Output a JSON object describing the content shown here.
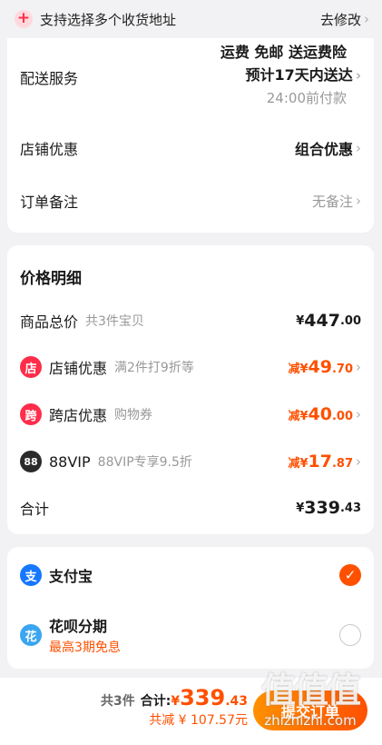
{
  "address": {
    "plus_icon": "+",
    "text": "支持选择多个收货地址",
    "modify": "去修改"
  },
  "shipping": {
    "label": "配送服务",
    "line1": "运费 免邮 送运费险",
    "line2": "预计17天内送达",
    "line3": "24:00前付款"
  },
  "store_discount": {
    "label": "店铺优惠",
    "value": "组合优惠"
  },
  "order_note": {
    "label": "订单备注",
    "value": "无备注"
  },
  "price_detail": {
    "title": "价格明细",
    "goods_total": {
      "label": "商品总价",
      "sub": "共3件宝贝",
      "yen": "¥",
      "int": "447",
      "dec": ".00"
    },
    "discounts": [
      {
        "icon_text": "店",
        "icon_color": "#ff2d4a",
        "label": "店铺优惠",
        "sub": "满2件打9折等",
        "pre": "减¥",
        "int": "49",
        "dec": ".70"
      },
      {
        "icon_text": "跨",
        "icon_color": "#ff2d4a",
        "label": "跨店优惠",
        "sub": "购物券",
        "pre": "减¥",
        "int": "40",
        "dec": ".00"
      },
      {
        "icon_text": "88",
        "icon_color": "#2b2b2b",
        "label": "88VIP",
        "sub": "88VIP专享9.5折",
        "pre": "减¥",
        "int": "17",
        "dec": ".87"
      }
    ],
    "total": {
      "label": "合计",
      "yen": "¥",
      "int": "339",
      "dec": ".43"
    }
  },
  "payment": {
    "alipay": {
      "name": "支付宝",
      "icon_text": "支",
      "color": "#1677ff",
      "check": "✓"
    },
    "huabei": {
      "name": "花呗分期",
      "sub": "最高3期免息",
      "icon_text": "花",
      "color": "#3aa5f0"
    }
  },
  "bottom": {
    "count": "共3件",
    "total_label": "合计:",
    "yen": "¥",
    "int": "339",
    "dec": ".43",
    "saved": "共减 ¥ 107.57元",
    "submit": "提交订单",
    "watermark_big": "值值值",
    "watermark_small": "zhizhizhi.com"
  },
  "colors": {
    "accent": "#ff5000",
    "bg": "#f2f2f4"
  }
}
